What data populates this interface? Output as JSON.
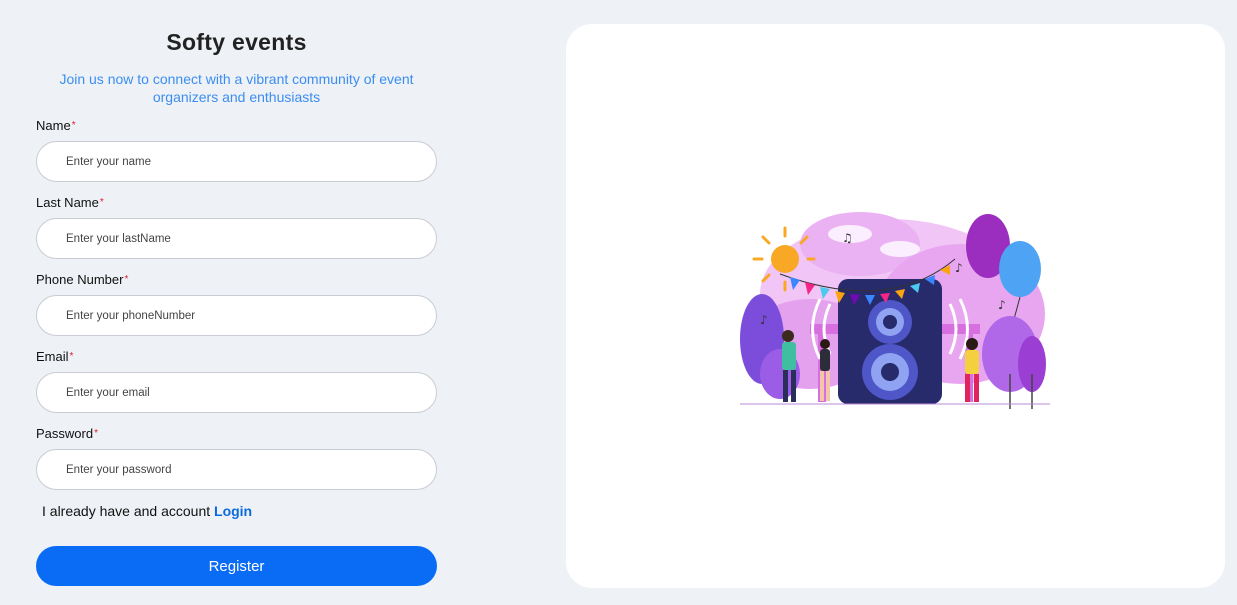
{
  "header": {
    "title": "Softy events",
    "subtitle": "Join us now to connect with a vibrant community of event organizers and enthusiasts"
  },
  "form": {
    "fields": [
      {
        "label": "Name",
        "required_mark": "*",
        "placeholder": "Enter your name",
        "value": ""
      },
      {
        "label": "Last Name",
        "required_mark": "*",
        "placeholder": "Enter your lastName",
        "value": ""
      },
      {
        "label": "Phone Number",
        "required_mark": "*",
        "placeholder": "Enter your phoneNumber",
        "value": ""
      },
      {
        "label": "Email",
        "required_mark": "*",
        "placeholder": "Enter your email",
        "value": ""
      },
      {
        "label": "Password",
        "required_mark": "*",
        "placeholder": "Enter your password",
        "value": ""
      }
    ],
    "login_prompt": "I already have and account",
    "login_link": "Login",
    "register_label": "Register"
  },
  "colors": {
    "background": "#eef1f6",
    "accent": "#0a6cf5",
    "subtitle": "#3b8ef0",
    "required": "#e11d2a"
  },
  "illustration": {
    "icon": "party-speaker-illustration"
  }
}
